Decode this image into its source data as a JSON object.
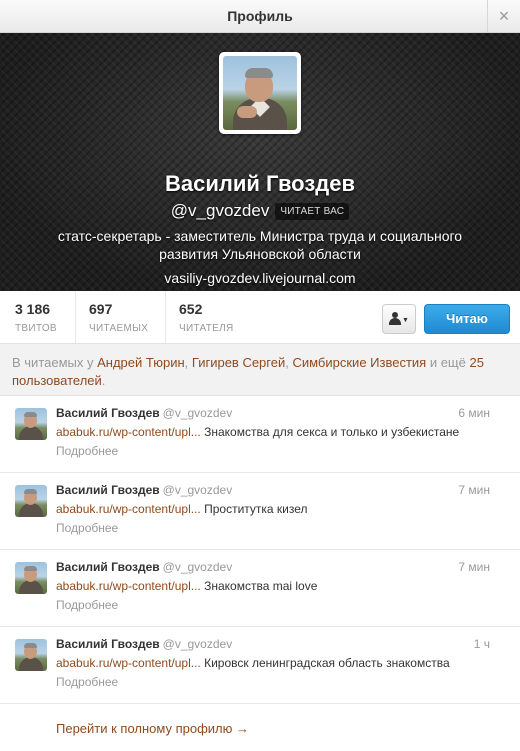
{
  "window": {
    "title": "Профиль",
    "close_glyph": "×"
  },
  "profile": {
    "name": "Василий Гвоздев",
    "handle": "@v_gvozdev",
    "follows_you": "ЧИТАЕТ ВАС",
    "bio": "статс-секретарь - заместитель Министра труда и социального развития Ульяновской области",
    "url": "vasiliy-gvozdev.livejournal.com"
  },
  "stats": [
    {
      "value": "3 186",
      "label": "ТВИТОВ"
    },
    {
      "value": "697",
      "label": "ЧИТАЕМЫХ"
    },
    {
      "value": "652",
      "label": "ЧИТАТЕЛЯ"
    }
  ],
  "actions": {
    "user_dropdown_caret": "▼",
    "follow_label": "Читаю"
  },
  "social_context": {
    "prefix": "В читаемых у ",
    "users": [
      "Андрей Тюрин",
      "Гигирев Сергей",
      "Симбирские Известия"
    ],
    "sep": ", ",
    "and_more": " и ещё ",
    "more_count_link": "25 пользователей",
    "suffix": "."
  },
  "tweets": [
    {
      "author": "Василий Гвоздев",
      "handle": "@v_gvozdev",
      "time": "6 мин",
      "link": "ababuk.ru/wp-content/upl...",
      "text": " Знакомства для секса и только и узбекистане",
      "more": "Подробнее"
    },
    {
      "author": "Василий Гвоздев",
      "handle": "@v_gvozdev",
      "time": "7 мин",
      "link": "ababuk.ru/wp-content/upl...",
      "text": " Проститутка кизел",
      "more": "Подробнее"
    },
    {
      "author": "Василий Гвоздев",
      "handle": "@v_gvozdev",
      "time": "7 мин",
      "link": "ababuk.ru/wp-content/upl...",
      "text": " Знакомства mai love",
      "more": "Подробнее"
    },
    {
      "author": "Василий Гвоздев",
      "handle": "@v_gvozdev",
      "time": "1 ч",
      "link": "ababuk.ru/wp-content/upl...",
      "text": " Кировск ленинградская область знакомства",
      "more": "Подробнее"
    }
  ],
  "footer": {
    "full_profile_link": "Перейти к полному профилю →"
  },
  "colors": {
    "link": "#8f4a1e",
    "follow_button": "#2b9be0",
    "hero_bg": "#2b2b2b"
  }
}
